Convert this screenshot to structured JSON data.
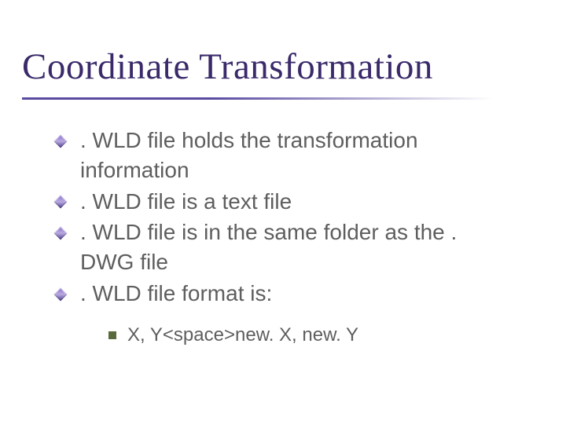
{
  "title": "Coordinate Transformation",
  "bullets": {
    "l1": [
      ". WLD file holds the transformation information",
      ". WLD file is a text file",
      ". WLD file is in the same folder as the . DWG file",
      ". WLD file format is:"
    ],
    "l2": [
      "X, Y<space>new. X, new. Y"
    ]
  }
}
